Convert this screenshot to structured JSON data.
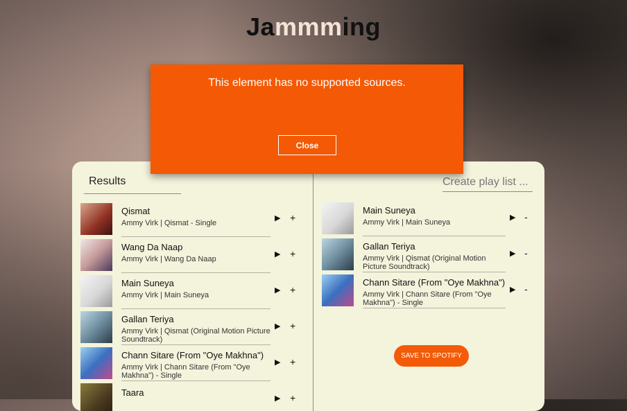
{
  "app": {
    "logo_part1": "Ja",
    "logo_part2": "mmm",
    "logo_part3": "ing"
  },
  "modal": {
    "message": "This element has no supported sources.",
    "close_label": "Close"
  },
  "results": {
    "heading": "Results",
    "tracks": [
      {
        "title": "Qismat",
        "subtitle": "Ammy Virk | Qismat - Single",
        "play": "▶",
        "action": "+"
      },
      {
        "title": "Wang Da Naap",
        "subtitle": "Ammy Virk | Wang Da Naap",
        "play": "▶",
        "action": "+"
      },
      {
        "title": "Main Suneya",
        "subtitle": "Ammy Virk | Main Suneya",
        "play": "▶",
        "action": "+"
      },
      {
        "title": "Gallan Teriya",
        "subtitle": "Ammy Virk | Qismat (Original Motion Picture Soundtrack)",
        "play": "▶",
        "action": "+"
      },
      {
        "title": "Chann Sitare (From \"Oye Makhna\")",
        "subtitle": "Ammy Virk | Chann Sitare (From \"Oye Makhna\") - Single",
        "play": "▶",
        "action": "+"
      },
      {
        "title": "Taara",
        "subtitle": "",
        "play": "▶",
        "action": "+"
      }
    ]
  },
  "playlist": {
    "name_placeholder": "Create play list ...",
    "save_label": "SAVE TO SPOTIFY",
    "tracks": [
      {
        "title": "Main Suneya",
        "subtitle": "Ammy Virk | Main Suneya",
        "play": "▶",
        "action": "-"
      },
      {
        "title": "Gallan Teriya",
        "subtitle": "Ammy Virk | Qismat (Original Motion Picture Soundtrack)",
        "play": "▶",
        "action": "-"
      },
      {
        "title": "Chann Sitare (From \"Oye Makhna\")",
        "subtitle": "Ammy Virk | Chann Sitare (From \"Oye Makhna\") - Single",
        "play": "▶",
        "action": "-"
      }
    ]
  },
  "colors": {
    "accent": "#f45b08",
    "panel": "#f4f3dc"
  }
}
